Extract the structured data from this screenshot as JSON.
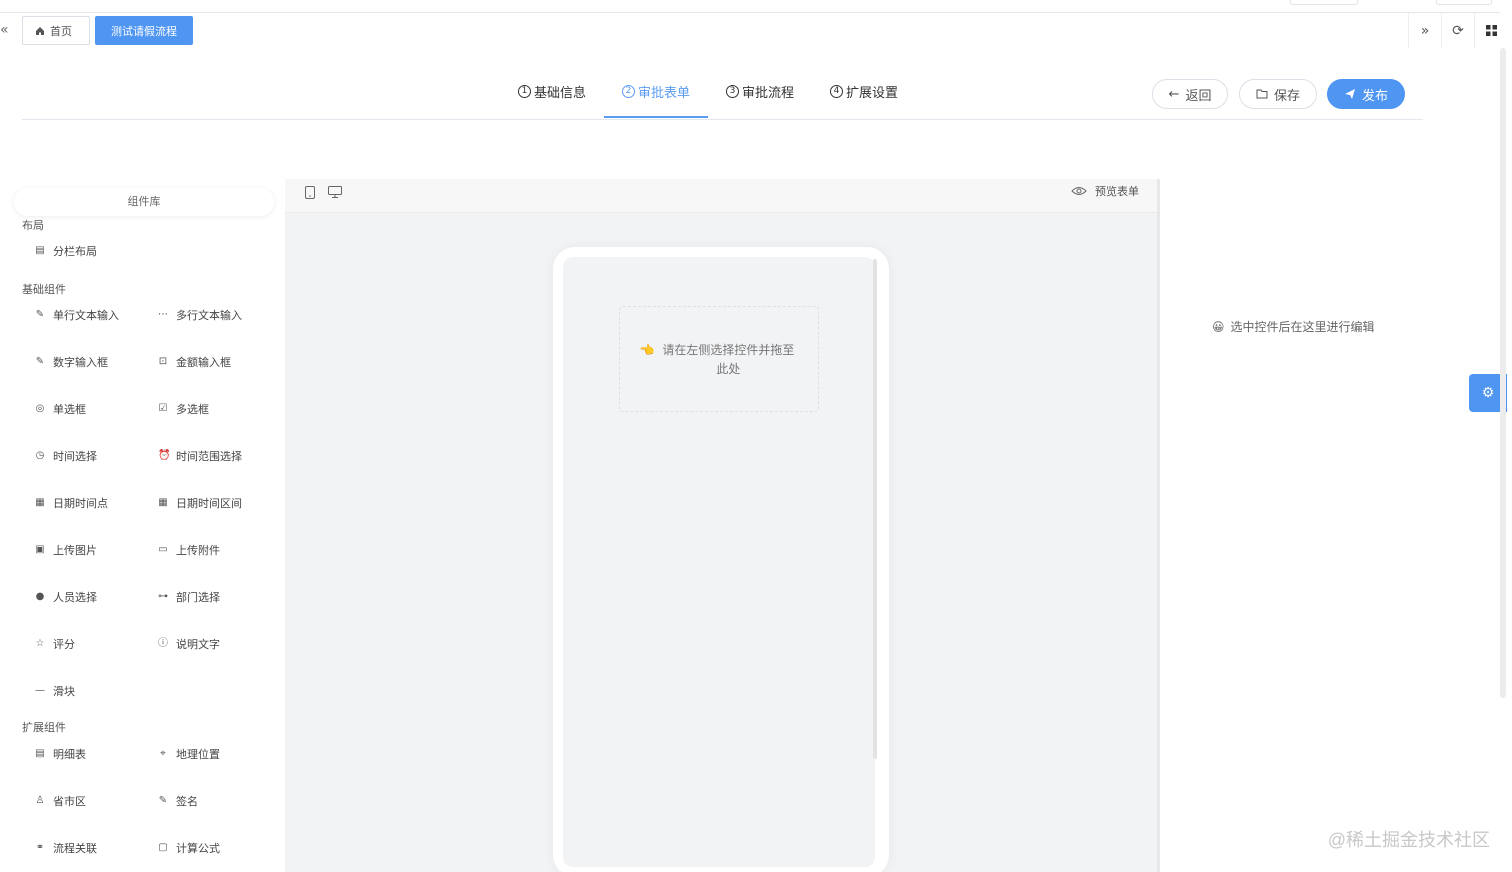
{
  "tabs": {
    "home_label": "首页",
    "active_label": "测试请假流程"
  },
  "steps": [
    {
      "num": "1",
      "label": "基础信息"
    },
    {
      "num": "2",
      "label": "审批表单"
    },
    {
      "num": "3",
      "label": "审批流程"
    },
    {
      "num": "4",
      "label": "扩展设置"
    }
  ],
  "actions": {
    "back": "返回",
    "save": "保存",
    "publish": "发布"
  },
  "library": {
    "title": "组件库",
    "sections": [
      {
        "title": "布局"
      },
      {
        "title": "基础组件"
      },
      {
        "title": "扩展组件"
      }
    ],
    "layout_items": [
      "分栏布局"
    ],
    "basic_items": [
      "单行文本输入",
      "多行文本输入",
      "数字输入框",
      "金额输入框",
      "单选框",
      "多选框",
      "时间选择",
      "时间范围选择",
      "日期时间点",
      "日期时间区间",
      "上传图片",
      "上传附件",
      "人员选择",
      "部门选择",
      "评分",
      "说明文字",
      "滑块"
    ],
    "ext_items": [
      "明细表",
      "地理位置",
      "省市区",
      "签名",
      "流程关联",
      "计算公式"
    ]
  },
  "canvas": {
    "preview_label": "预览表单",
    "drop_text": "请在左侧选择控件并拖至此处"
  },
  "props": {
    "hint": "选中控件后在这里进行编辑"
  },
  "watermark": "@稀土掘金技术社区",
  "colors": {
    "primary": "#4f95f2"
  }
}
